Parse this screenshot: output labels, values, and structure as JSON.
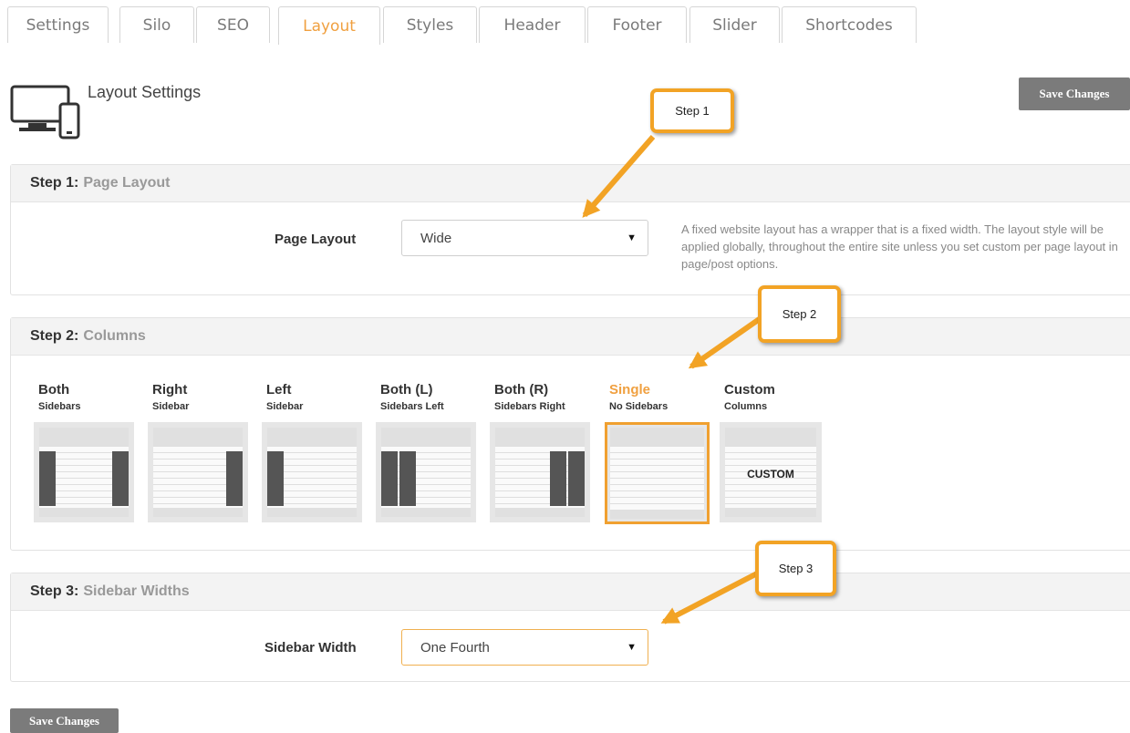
{
  "tabs": [
    {
      "label": "Settings",
      "active": false
    },
    {
      "label": "Silo",
      "active": false
    },
    {
      "label": "SEO",
      "active": false
    },
    {
      "label": "Layout",
      "active": true
    },
    {
      "label": "Styles",
      "active": false
    },
    {
      "label": "Header",
      "active": false
    },
    {
      "label": "Footer",
      "active": false
    },
    {
      "label": "Slider",
      "active": false
    },
    {
      "label": "Shortcodes",
      "active": false
    }
  ],
  "header": {
    "title": "Layout Settings",
    "icon": "monitor-mobile-icon"
  },
  "save_label": "Save Changes",
  "step1": {
    "step": "Step 1:",
    "title": "Page Layout",
    "field_label": "Page Layout",
    "value": "Wide",
    "help": "A fixed website layout has a wrapper that is a fixed width. The layout style will be applied globally, throughout the entire site unless you set custom per page layout in page/post options."
  },
  "step2": {
    "step": "Step 2:",
    "title": "Columns",
    "options": [
      {
        "title": "Both",
        "sub": "Sidebars",
        "selected": false
      },
      {
        "title": "Right",
        "sub": "Sidebar",
        "selected": false
      },
      {
        "title": "Left",
        "sub": "Sidebar",
        "selected": false
      },
      {
        "title": "Both (L)",
        "sub": "Sidebars Left",
        "selected": false
      },
      {
        "title": "Both (R)",
        "sub": "Sidebars Right",
        "selected": false
      },
      {
        "title": "Single",
        "sub": "No Sidebars",
        "selected": true
      },
      {
        "title": "Custom",
        "sub": "Columns",
        "selected": false,
        "thumb_text": "CUSTOM"
      }
    ]
  },
  "step3": {
    "step": "Step 3:",
    "title": "Sidebar Widths",
    "field_label": "Sidebar Width",
    "value": "One Fourth"
  },
  "callouts": {
    "c1": "Step 1",
    "c2": "Step 2",
    "c3": "Step 3"
  },
  "colors": {
    "accent": "#f0a040",
    "callout_border": "#f2a325",
    "button": "#7b7b7b"
  }
}
